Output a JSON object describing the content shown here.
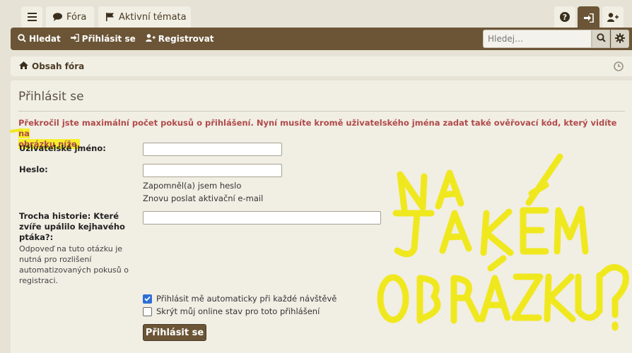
{
  "tabs": {
    "menu_icon": "hamburger-icon",
    "fora_label": "Fóra",
    "active_topics_label": "Aktivní témata",
    "help_icon": "question-icon",
    "login_icon": "sign-in-icon",
    "register_icon": "user-plus-icon"
  },
  "navbar": {
    "search_label": "Hledat",
    "login_label": "Přihlásit se",
    "register_label": "Registrovat",
    "search_placeholder": "Hledej…"
  },
  "breadcrumb": {
    "home_label": "Obsah fóra"
  },
  "form": {
    "title": "Přihlásit se",
    "error_main": "Překročil jste maximální počet pokusů o přihlášení. Nyní musíte kromě uživatelského jména zadat také ověřovací kód, který vidíte ",
    "error_highlight1": "na",
    "error_highlight2": "obrázku níže.",
    "username_label": "Uživatelské jméno:",
    "password_label": "Heslo:",
    "forgot_password": "Zapomněl(a) jsem heslo",
    "resend_activation": "Znovu poslat aktivační e-mail",
    "question_label": "Trocha historie: Které zvíře upálilo kejhavého ptáka?:",
    "question_explain": "Odpoveď na tuto otázku je nutná pro rozlišení automatizovaných pokusů o registraci.",
    "autologin_label": "Přihlásit mě automaticky při každé návštěvě",
    "autologin_checked": true,
    "hide_online_label": "Skrýt můj online stav pro toto přihlášení",
    "hide_online_checked": false,
    "submit_label": "Přihlásit se"
  },
  "colors": {
    "accent": "#6b5536",
    "error": "#b04a4a",
    "highlight": "#f6ee2a",
    "checkbox": "#2d6fd6"
  }
}
